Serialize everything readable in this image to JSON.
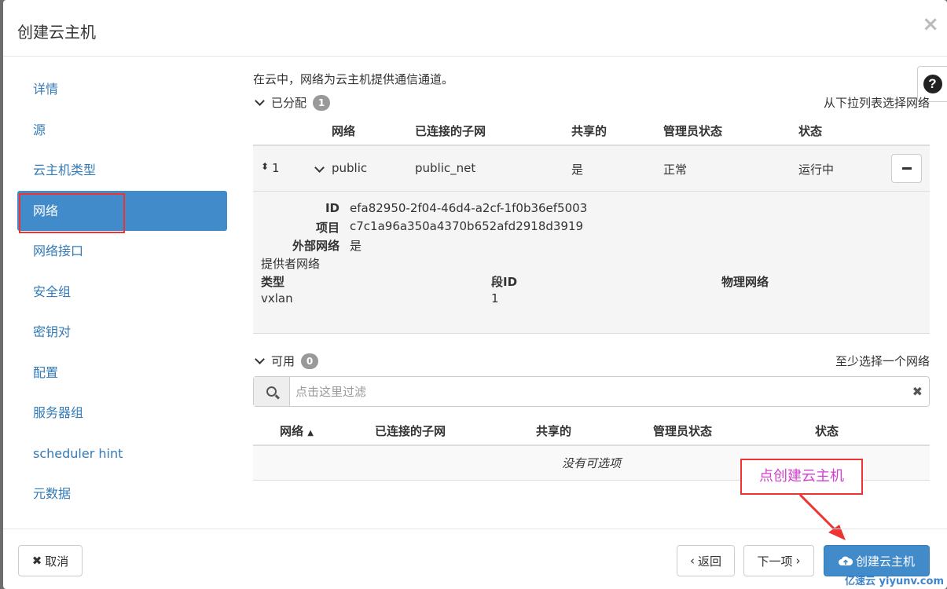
{
  "dialog": {
    "title": "创建云主机",
    "close_glyph": "×"
  },
  "sidebar": {
    "items": [
      {
        "label": "详情"
      },
      {
        "label": "源"
      },
      {
        "label": "云主机类型"
      },
      {
        "label": "网络",
        "active": true
      },
      {
        "label": "网络接口"
      },
      {
        "label": "安全组"
      },
      {
        "label": "密钥对"
      },
      {
        "label": "配置"
      },
      {
        "label": "服务器组"
      },
      {
        "label": "scheduler hint"
      },
      {
        "label": "元数据"
      }
    ]
  },
  "help": {
    "glyph": "?"
  },
  "main": {
    "intro": "在云中，网络为云主机提供通信通道。",
    "allocated": {
      "label": "已分配",
      "count": "1",
      "hint": "从下拉列表选择网络",
      "columns": [
        "网络",
        "已连接的子网",
        "共享的",
        "管理员状态",
        "状态"
      ],
      "row": {
        "order": "1",
        "network": "public",
        "subnet": "public_net",
        "shared": "是",
        "admin_state": "正常",
        "status": "运行中"
      },
      "details": {
        "id_label": "ID",
        "id_value": "efa82950-2f04-46d4-a2cf-1f0b36ef5003",
        "project_label": "项目",
        "project_value": "c7c1a96a350a4370b652afd2918d3919",
        "external_label": "外部网络",
        "external_value": "是",
        "provider_label": "提供者网络",
        "type_label": "类型",
        "type_value": "vxlan",
        "segment_label": "段ID",
        "segment_value": "1",
        "physical_label": "物理网络"
      }
    },
    "available": {
      "label": "可用",
      "count": "0",
      "hint": "至少选择一个网络",
      "filter_placeholder": "点击这里过滤",
      "columns": [
        "网络",
        "已连接的子网",
        "共享的",
        "管理员状态",
        "状态"
      ],
      "sort_indicator": "▲",
      "empty_text": "没有可选项"
    }
  },
  "annotation": {
    "text": "点创建云主机",
    "color": "#d33fcf"
  },
  "footer": {
    "cancel_label": "取消",
    "back_label": "返回",
    "next_label": "下一项",
    "create_label": "创建云主机"
  },
  "watermark": "亿速云 yiyunv.com",
  "colors": {
    "primary": "#428bca",
    "highlight_border": "#e33",
    "link": "#337ab7"
  }
}
